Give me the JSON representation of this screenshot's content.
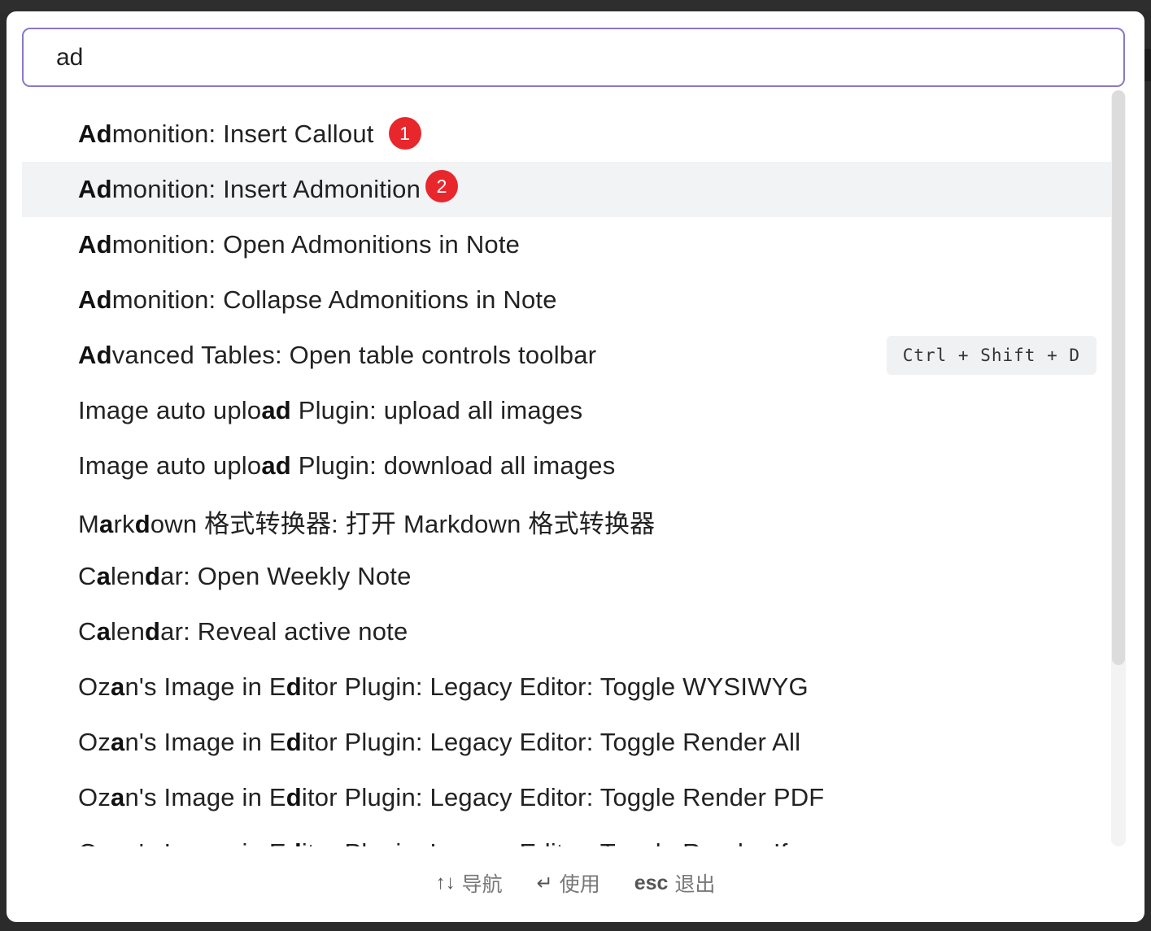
{
  "search": {
    "value": "ad",
    "placeholder": ""
  },
  "results": [
    {
      "segments": [
        {
          "t": "Ad",
          "b": true
        },
        {
          "t": "monition: Insert Callout",
          "b": false
        }
      ],
      "badge": "1",
      "selected": false
    },
    {
      "segments": [
        {
          "t": "Ad",
          "b": true
        },
        {
          "t": "monition: Insert Admonition",
          "b": false
        }
      ],
      "badge": "2",
      "selected": true
    },
    {
      "segments": [
        {
          "t": "Ad",
          "b": true
        },
        {
          "t": "monition: Open Admonitions in Note",
          "b": false
        }
      ]
    },
    {
      "segments": [
        {
          "t": "Ad",
          "b": true
        },
        {
          "t": "monition: Collapse Admonitions in Note",
          "b": false
        }
      ]
    },
    {
      "segments": [
        {
          "t": "Ad",
          "b": true
        },
        {
          "t": "vanced Tables: Open table controls toolbar",
          "b": false
        }
      ],
      "hotkey": "Ctrl + Shift + D"
    },
    {
      "segments": [
        {
          "t": "Image auto uplo",
          "b": false
        },
        {
          "t": "ad",
          "b": true
        },
        {
          "t": " Plugin: upload all images",
          "b": false
        }
      ]
    },
    {
      "segments": [
        {
          "t": "Image auto uplo",
          "b": false
        },
        {
          "t": "ad",
          "b": true
        },
        {
          "t": " Plugin: download all images",
          "b": false
        }
      ]
    },
    {
      "segments": [
        {
          "t": "M",
          "b": false
        },
        {
          "t": "a",
          "b": true
        },
        {
          "t": "rk",
          "b": false
        },
        {
          "t": "d",
          "b": true
        },
        {
          "t": "own 格式转换器: 打开 Markdown 格式转换器",
          "b": false
        }
      ]
    },
    {
      "segments": [
        {
          "t": "C",
          "b": false
        },
        {
          "t": "a",
          "b": true
        },
        {
          "t": "len",
          "b": false
        },
        {
          "t": "d",
          "b": true
        },
        {
          "t": "ar: Open Weekly Note",
          "b": false
        }
      ]
    },
    {
      "segments": [
        {
          "t": "C",
          "b": false
        },
        {
          "t": "a",
          "b": true
        },
        {
          "t": "len",
          "b": false
        },
        {
          "t": "d",
          "b": true
        },
        {
          "t": "ar: Reveal active note",
          "b": false
        }
      ]
    },
    {
      "segments": [
        {
          "t": "Oz",
          "b": false
        },
        {
          "t": "a",
          "b": true
        },
        {
          "t": "n's Image in E",
          "b": false
        },
        {
          "t": "d",
          "b": true
        },
        {
          "t": "itor Plugin: Legacy Editor: Toggle WYSIWYG",
          "b": false
        }
      ]
    },
    {
      "segments": [
        {
          "t": "Oz",
          "b": false
        },
        {
          "t": "a",
          "b": true
        },
        {
          "t": "n's Image in E",
          "b": false
        },
        {
          "t": "d",
          "b": true
        },
        {
          "t": "itor Plugin: Legacy Editor: Toggle Render All",
          "b": false
        }
      ]
    },
    {
      "segments": [
        {
          "t": "Oz",
          "b": false
        },
        {
          "t": "a",
          "b": true
        },
        {
          "t": "n's Image in E",
          "b": false
        },
        {
          "t": "d",
          "b": true
        },
        {
          "t": "itor Plugin: Legacy Editor: Toggle Render PDF",
          "b": false
        }
      ]
    },
    {
      "segments": [
        {
          "t": "Oz",
          "b": false
        },
        {
          "t": "a",
          "b": true
        },
        {
          "t": "n's Image in E",
          "b": false
        },
        {
          "t": "d",
          "b": true
        },
        {
          "t": "itor Plugin: Legacy Editor: Toggle Render Iframe",
          "b": false
        }
      ]
    }
  ],
  "footer": {
    "navigate_symbol": "↑↓",
    "navigate_label": "导航",
    "use_symbol": "↵",
    "use_label": "使用",
    "esc_key": "esc",
    "esc_label": "退出"
  },
  "colors": {
    "accent_border": "#8a78c8",
    "badge": "#e8272d",
    "selected_row": "#f2f3f5"
  }
}
